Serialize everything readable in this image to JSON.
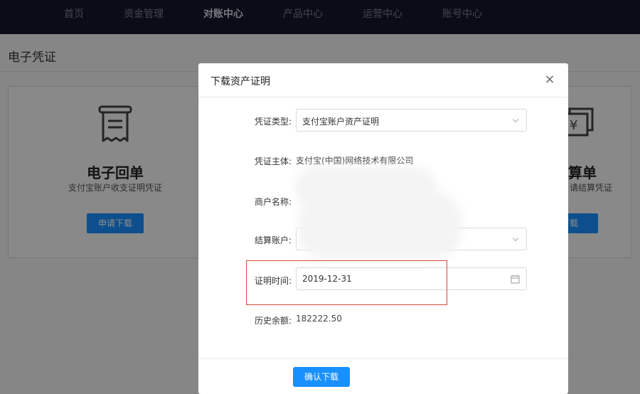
{
  "nav": {
    "items": [
      {
        "label": "首页"
      },
      {
        "label": "资金管理"
      },
      {
        "label": "对账中心"
      },
      {
        "label": "产品中心"
      },
      {
        "label": "运营中心"
      },
      {
        "label": "账号中心"
      }
    ],
    "active_index": 2
  },
  "page": {
    "title": "电子凭证"
  },
  "cards": {
    "left": {
      "title": "电子回单",
      "desc": "支付宝账户收支证明凭证",
      "button": "申请下载",
      "icon": "receipt-icon"
    },
    "right": {
      "title": "算单",
      "desc": "请结算凭证",
      "button": "下载",
      "icon": "statement-icon"
    }
  },
  "modal": {
    "title": "下载资产证明",
    "close": "×",
    "fields": {
      "voucher_type": {
        "label": "凭证类型:",
        "value": "支付宝账户资产证明"
      },
      "voucher_subject": {
        "label": "凭证主体:",
        "value": "支付宝(中国)网络技术有限公司"
      },
      "merchant_name": {
        "label": "商户名称:",
        "value": ""
      },
      "settlement_account": {
        "label": "结算账户:",
        "value": ""
      },
      "proof_date": {
        "label": "证明时间:",
        "value": "2019-12-31"
      },
      "history_balance": {
        "label": "历史余额:",
        "value": "182222.50"
      }
    },
    "confirm_button": "确认下载"
  },
  "colors": {
    "nav_bg": "#15172a",
    "primary": "#1890ff",
    "highlight": "#d9463c"
  }
}
